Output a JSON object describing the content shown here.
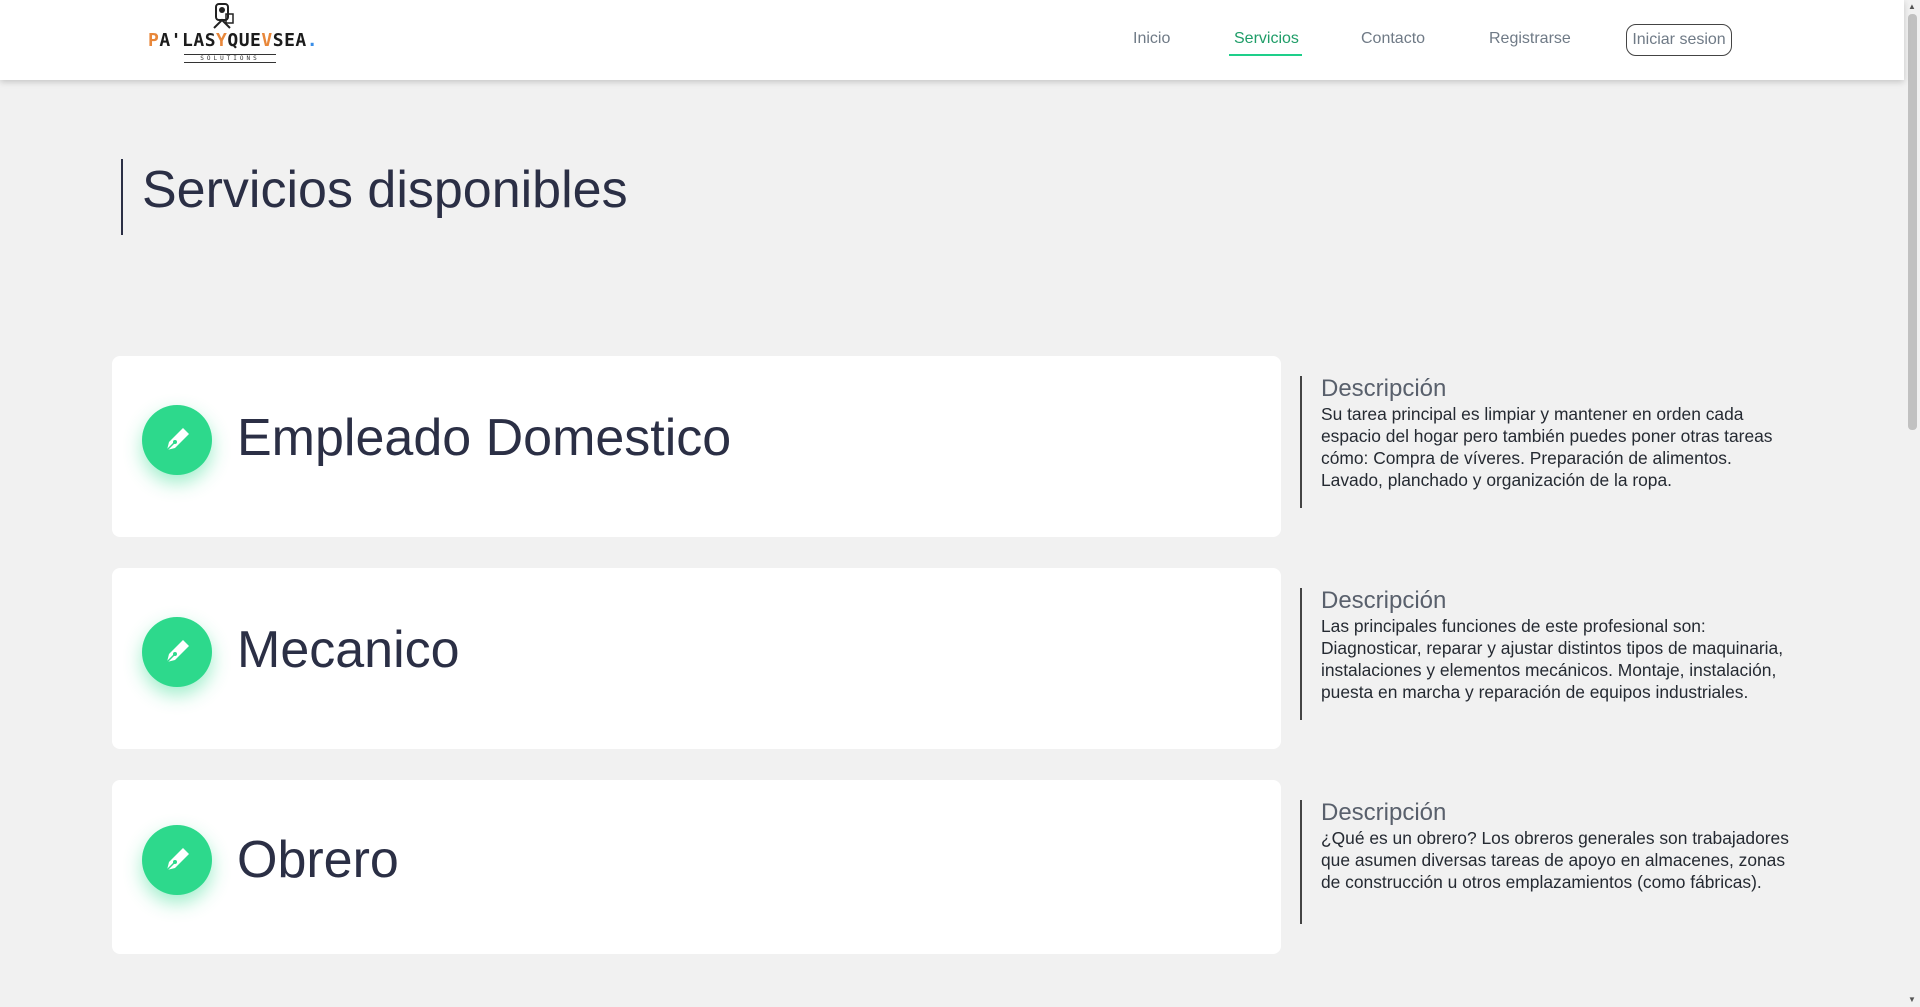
{
  "header": {
    "logo": {
      "text_main": "PA'LAS QUE SEA",
      "text_sub": "SOLUTIONS"
    },
    "nav": [
      {
        "label": "Inicio"
      },
      {
        "label": "Servicios",
        "active": true
      },
      {
        "label": "Contacto"
      },
      {
        "label": "Registrarse"
      }
    ],
    "login_label": "Iniciar sesion",
    "accent_color": "#1ecf8a"
  },
  "main": {
    "title": "Servicios disponibles",
    "services": [
      {
        "title": "Empleado Domestico",
        "icon": "pen-nib-icon",
        "description_heading": "Descripción",
        "description_lines": [
          "Su tarea principal es limpiar y mantener en orden cada",
          "espacio del hogar pero también puedes poner otras tareas",
          "cómo: Compra de víveres. Preparación de alimentos.",
          "Lavado, planchado y organización de la ropa."
        ]
      },
      {
        "title": "Mecanico",
        "icon": "pen-nib-icon",
        "description_heading": "Descripción",
        "description_lines": [
          "Las principales funciones de este profesional son:",
          "Diagnosticar, reparar y ajustar distintos tipos de maquinaria,",
          "instalaciones y elementos mecánicos. Montaje, instalación,",
          "puesta en marcha y reparación de equipos industriales."
        ]
      },
      {
        "title": "Obrero",
        "icon": "pen-nib-icon",
        "description_heading": "Descripción",
        "description_lines": [
          "¿Qué es un obrero? Los obreros generales son trabajadores",
          "que asumen diversas tareas de apoyo en almacenes, zonas",
          "de construcción u otros emplazamientos (como fábricas)."
        ]
      }
    ],
    "icon_color": "#2dd98c"
  }
}
